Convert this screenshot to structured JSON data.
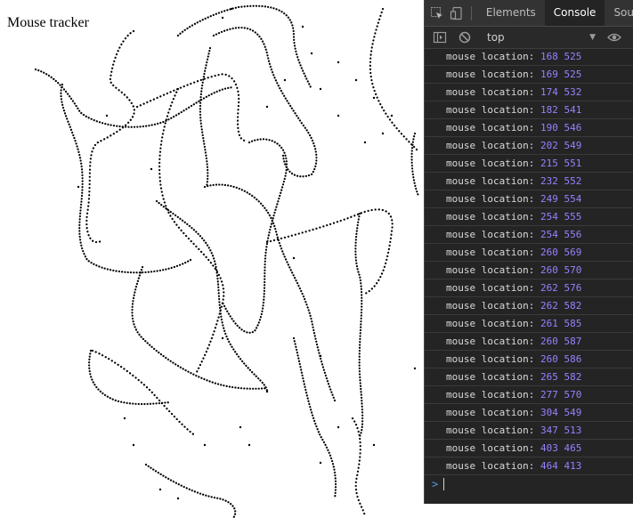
{
  "page": {
    "title": "Mouse tracker"
  },
  "devtools": {
    "tabs": [
      {
        "label": "Elements",
        "active": false
      },
      {
        "label": "Console",
        "active": true
      },
      {
        "label": "Sou",
        "active": false
      }
    ],
    "icons": {
      "inspect": "inspect-element-icon",
      "device": "device-toolbar-icon",
      "sidebar": "console-sidebar-icon",
      "clear": "clear-console-icon",
      "eye": "eye-icon"
    },
    "context": "top",
    "log_label": "mouse location:",
    "logs": [
      {
        "x": "168",
        "y": "525"
      },
      {
        "x": "169",
        "y": "525"
      },
      {
        "x": "174",
        "y": "532"
      },
      {
        "x": "182",
        "y": "541"
      },
      {
        "x": "190",
        "y": "546"
      },
      {
        "x": "202",
        "y": "549"
      },
      {
        "x": "215",
        "y": "551"
      },
      {
        "x": "232",
        "y": "552"
      },
      {
        "x": "249",
        "y": "554"
      },
      {
        "x": "254",
        "y": "555"
      },
      {
        "x": "254",
        "y": "556"
      },
      {
        "x": "260",
        "y": "569"
      },
      {
        "x": "260",
        "y": "570"
      },
      {
        "x": "262",
        "y": "576"
      },
      {
        "x": "262",
        "y": "582"
      },
      {
        "x": "261",
        "y": "585"
      },
      {
        "x": "260",
        "y": "587"
      },
      {
        "x": "260",
        "y": "586"
      },
      {
        "x": "265",
        "y": "582"
      },
      {
        "x": "277",
        "y": "570"
      },
      {
        "x": "304",
        "y": "549"
      },
      {
        "x": "347",
        "y": "513"
      },
      {
        "x": "403",
        "y": "465"
      },
      {
        "x": "464",
        "y": "413"
      }
    ],
    "colors": {
      "panel_bg": "#242424",
      "number": "#9980ff",
      "prompt": "#4d9de0",
      "trail": "#000000"
    }
  }
}
